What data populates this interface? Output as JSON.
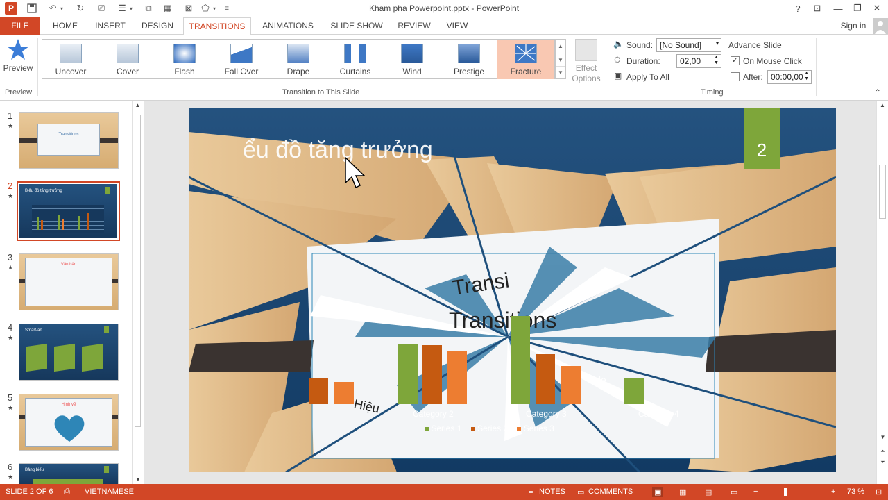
{
  "window": {
    "title": "Kham pha Powerpoint.pptx - PowerPoint",
    "help": "?",
    "sign_in": "Sign in"
  },
  "tabs": [
    "FILE",
    "HOME",
    "INSERT",
    "DESIGN",
    "TRANSITIONS",
    "ANIMATIONS",
    "SLIDE SHOW",
    "REVIEW",
    "VIEW"
  ],
  "ribbon": {
    "preview_label": "Preview",
    "preview_group": "Preview",
    "gallery": [
      "Uncover",
      "Cover",
      "Flash",
      "Fall Over",
      "Drape",
      "Curtains",
      "Wind",
      "Prestige",
      "Fracture"
    ],
    "selected_transition": "Fracture",
    "effect_options": "Effect Options",
    "group_transition": "Transition to This Slide",
    "sound_label": "Sound:",
    "sound_value": "[No Sound]",
    "duration_label": "Duration:",
    "duration_value": "02,00",
    "apply_all": "Apply To All",
    "advance_title": "Advance Slide",
    "on_mouse_click": "On Mouse Click",
    "after_label": "After:",
    "after_value": "00:00,00",
    "timing_group": "Timing"
  },
  "slides": [
    {
      "num": "1",
      "title": "Transitions",
      "kind": "light"
    },
    {
      "num": "2",
      "title": "Biểu đồ tăng trưởng",
      "kind": "dark"
    },
    {
      "num": "3",
      "title": "Văn bản",
      "kind": "light"
    },
    {
      "num": "4",
      "title": "Smart-art",
      "kind": "dark"
    },
    {
      "num": "5",
      "title": "Hình vẽ",
      "kind": "light"
    },
    {
      "num": "6",
      "title": "Bảng biểu",
      "kind": "dark"
    }
  ],
  "slide": {
    "title": "ểu đồ tăng trưởng",
    "number": "2",
    "center_text_1": "Transi",
    "center_text_2": "Transitions",
    "categories": [
      "Category 2",
      "Category 3",
      "Category 4"
    ],
    "legend": [
      "Series 1",
      "Series 2",
      "Series 3"
    ],
    "frag_text_1": "Hiệu",
    "frag_text_2": "lide"
  },
  "colors": {
    "accent": "#d24726",
    "series1": "#7ea63a",
    "series2": "#c55a11",
    "series3": "#ed7d31",
    "slide_bg": "#1e4f7c"
  },
  "status": {
    "slide": "SLIDE 2 OF 6",
    "language": "VIETNAMESE",
    "notes": "NOTES",
    "comments": "COMMENTS",
    "zoom": "73 %"
  }
}
